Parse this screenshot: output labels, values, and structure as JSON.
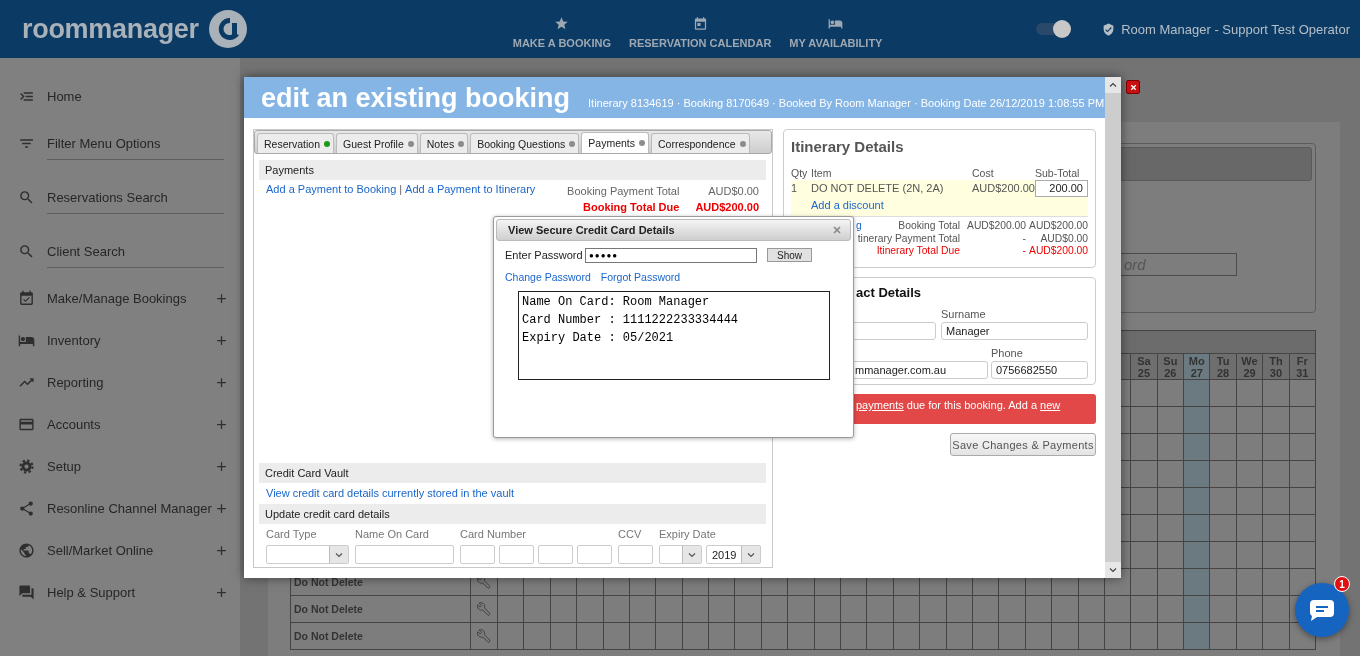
{
  "header": {
    "logo": "roommanager",
    "nav": [
      {
        "label": "MAKE A BOOKING"
      },
      {
        "label": "RESERVATION CALENDAR"
      },
      {
        "label": "MY AVAILABILITY"
      }
    ],
    "toggle": {
      "on": true
    },
    "user": "Room Manager - Support Test Operator"
  },
  "sidebar": {
    "items": [
      {
        "label": "Home",
        "kind": "nav"
      },
      {
        "label": "Filter Menu Options",
        "kind": "field"
      },
      {
        "label": "Reservations Search",
        "kind": "field"
      },
      {
        "label": "Client Search",
        "kind": "field"
      },
      {
        "label": "Make/Manage Bookings",
        "kind": "group"
      },
      {
        "label": "Inventory",
        "kind": "group"
      },
      {
        "label": "Reporting",
        "kind": "group"
      },
      {
        "label": "Accounts",
        "kind": "group"
      },
      {
        "label": "Setup",
        "kind": "group"
      },
      {
        "label": "Resonline Channel Manager",
        "kind": "group"
      },
      {
        "label": "Sell/Market Online",
        "kind": "group"
      },
      {
        "label": "Help & Support",
        "kind": "group"
      }
    ]
  },
  "background": {
    "search_placeholder": "ord",
    "calendar": {
      "days": [
        {
          "weekday": "Sa",
          "date": "25",
          "today": false
        },
        {
          "weekday": "Su",
          "date": "26",
          "today": false
        },
        {
          "weekday": "Mo",
          "date": "27",
          "today": true
        },
        {
          "weekday": "Tu",
          "date": "28",
          "today": false
        },
        {
          "weekday": "We",
          "date": "29",
          "today": false
        },
        {
          "weekday": "Th",
          "date": "30",
          "today": false
        },
        {
          "weekday": "Fr",
          "date": "31",
          "today": false
        }
      ],
      "rows": [
        {
          "name": "Do Not Delete"
        },
        {
          "name": "Do Not Delete"
        },
        {
          "name": "Do Not Delete"
        }
      ]
    }
  },
  "modal": {
    "title": "edit an existing booking",
    "meta": "Itinerary 8134619 · Booking 8170649 · Booked By Room Manager · Booking Date 26/12/2019 1:08:55 PM",
    "tabs": [
      {
        "label": "Reservation",
        "selected": false,
        "color": "#1a9a1a"
      },
      {
        "label": "Guest Profile",
        "selected": false,
        "color": "#8c8c8c"
      },
      {
        "label": "Notes",
        "selected": false,
        "color": "#8c8c8c"
      },
      {
        "label": "Booking Questions",
        "selected": false,
        "color": "#8c8c8c"
      },
      {
        "label": "Payments",
        "selected": true,
        "color": "#8c8c8c"
      },
      {
        "label": "Correspondence",
        "selected": false,
        "color": "#8c8c8c"
      }
    ],
    "payments": {
      "heading": "Payments",
      "links": [
        "Add a Payment to Booking",
        "Add a Payment to Itinerary"
      ],
      "separator": "|",
      "totals": [
        {
          "label": "Booking Payment Total",
          "value": "AUD$0.00",
          "kind": "normal"
        },
        {
          "label": "Booking Total Due",
          "value": "AUD$200.00",
          "kind": "due"
        }
      ]
    },
    "vault": {
      "heading": "Credit Card Vault",
      "link": "View credit card details currently stored in the vault"
    },
    "update": {
      "heading": "Update credit card details",
      "fields": [
        {
          "label": "Card Type",
          "kind": "select"
        },
        {
          "label": "Name On Card",
          "kind": "text"
        },
        {
          "label": "Card Number",
          "kind": "card-number"
        },
        {
          "label": "CCV",
          "kind": "ccv"
        },
        {
          "label": "Expiry Date",
          "kind": "expiry",
          "year": "2019"
        }
      ]
    },
    "itinerary": {
      "title": "Itinerary Details",
      "columns": [
        "Qty",
        "Item",
        "Cost",
        "Sub-Total"
      ],
      "items": [
        {
          "qty": "1",
          "item": "DO NOT DELETE (2N, 2A)",
          "cost": "AUD$200.00",
          "subtotal": "200.00",
          "link": "Add a discount"
        }
      ],
      "partial_link": "g",
      "totals": [
        {
          "label": "Booking Total",
          "col1": "AUD$200.00",
          "col2": "AUD$200.00",
          "kind": "normal"
        },
        {
          "label": "tinerary Payment Total",
          "col1": "-",
          "col2": "AUD$0.00",
          "kind": "normal"
        },
        {
          "label": "Itinerary Total Due",
          "col1": "-",
          "col2": "AUD$200.00",
          "kind": "due"
        }
      ]
    },
    "contact": {
      "title": "act Details",
      "surname_label": "Surname",
      "surname": "Manager",
      "email": "mmanager.com.au",
      "phone_label": "Phone",
      "phone": "0756682550"
    },
    "alert": {
      "parts": [
        {
          "text": "payments",
          "link": true
        },
        {
          "text": " due for this booking. Add a ",
          "link": false
        },
        {
          "text": "new",
          "link": true
        }
      ]
    },
    "save_button": "Save Changes & Payments",
    "popup": {
      "title": "View Secure Credit Card Details",
      "password_label": "Enter Password",
      "password_value": "●●●●●",
      "show_button": "Show",
      "links": [
        "Change Password",
        "Forgot Password"
      ],
      "details": [
        "Name On Card: Room Manager",
        "Card Number : 1111222233334444",
        "Expiry Date : 05/2021"
      ]
    }
  },
  "chat": {
    "badge": "1"
  }
}
